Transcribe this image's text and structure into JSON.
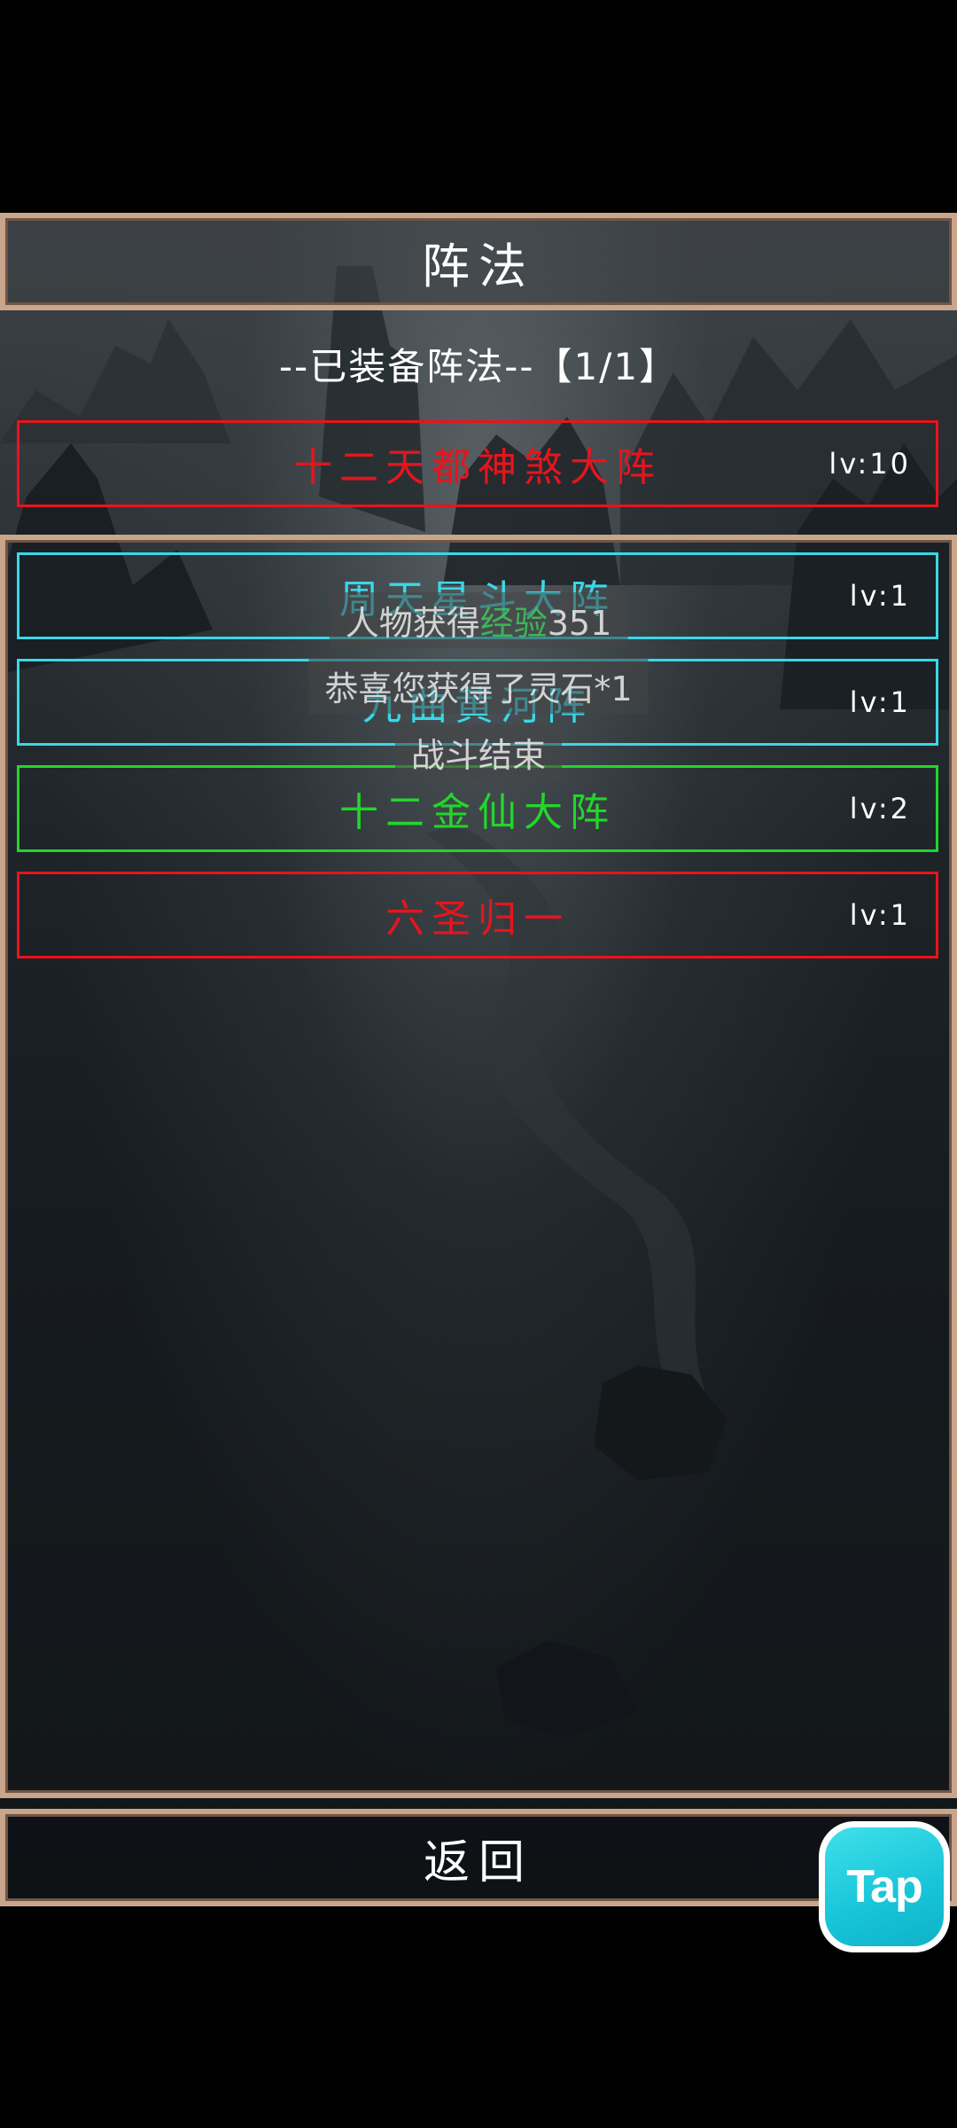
{
  "header": {
    "title": "阵法"
  },
  "equipped": {
    "heading": "--已装备阵法--【1/1】",
    "item": {
      "name": "十二天都神煞大阵",
      "level": "lv:10",
      "color": "#e8141c"
    }
  },
  "formations": [
    {
      "name": "周天星斗大阵",
      "level": "lv:1",
      "color": "#3ad8e6"
    },
    {
      "name": "九曲黄河阵",
      "level": "lv:1",
      "color": "#3ad8e6"
    },
    {
      "name": "十二金仙大阵",
      "level": "lv:2",
      "color": "#22d62a"
    },
    {
      "name": "六圣归一",
      "level": "lv:1",
      "color": "#e8141c"
    }
  ],
  "toasts": {
    "exp_prefix": "人物获得",
    "exp_highlight": "经验",
    "exp_value": "351",
    "reward": "恭喜您获得了灵石*1",
    "battle_end": "战斗结束"
  },
  "footer": {
    "back_label": "返回"
  },
  "badge": {
    "label": "Tap",
    "color": "#17c4d8"
  }
}
